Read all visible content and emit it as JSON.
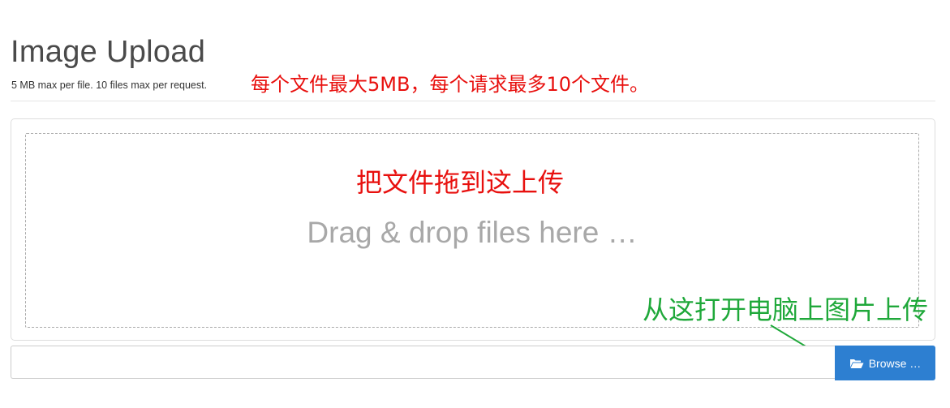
{
  "header": {
    "title": "Image Upload",
    "subtitle": "5 MB max per file. 10 files max per request.",
    "annotation_limit": "每个文件最大5MB，每个请求最多10个文件。"
  },
  "dropzone": {
    "annotation": "把文件拖到这上传",
    "caption": "Drag & drop files here …"
  },
  "browse": {
    "annotation": "从这打开电脑上图片上传",
    "button_label": "Browse …",
    "icon": "folder-open-icon"
  },
  "file_input": {
    "value": ""
  },
  "colors": {
    "annotation_red": "#e8100e",
    "annotation_green": "#1fa83a",
    "button_blue": "#2d7fd1"
  }
}
